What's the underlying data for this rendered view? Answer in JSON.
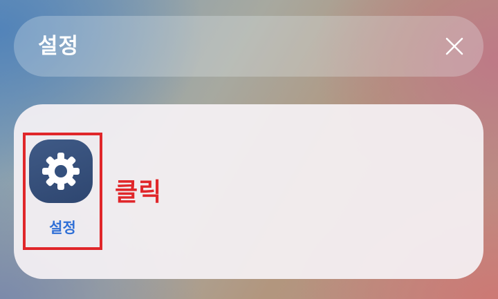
{
  "search": {
    "query": "설정",
    "close_icon": "close-icon"
  },
  "results": {
    "apps": [
      {
        "label": "설정",
        "icon": "gear-icon",
        "icon_bg_color": "#34507d"
      }
    ]
  },
  "annotation": {
    "text": "클릭",
    "color": "#e0262a"
  }
}
